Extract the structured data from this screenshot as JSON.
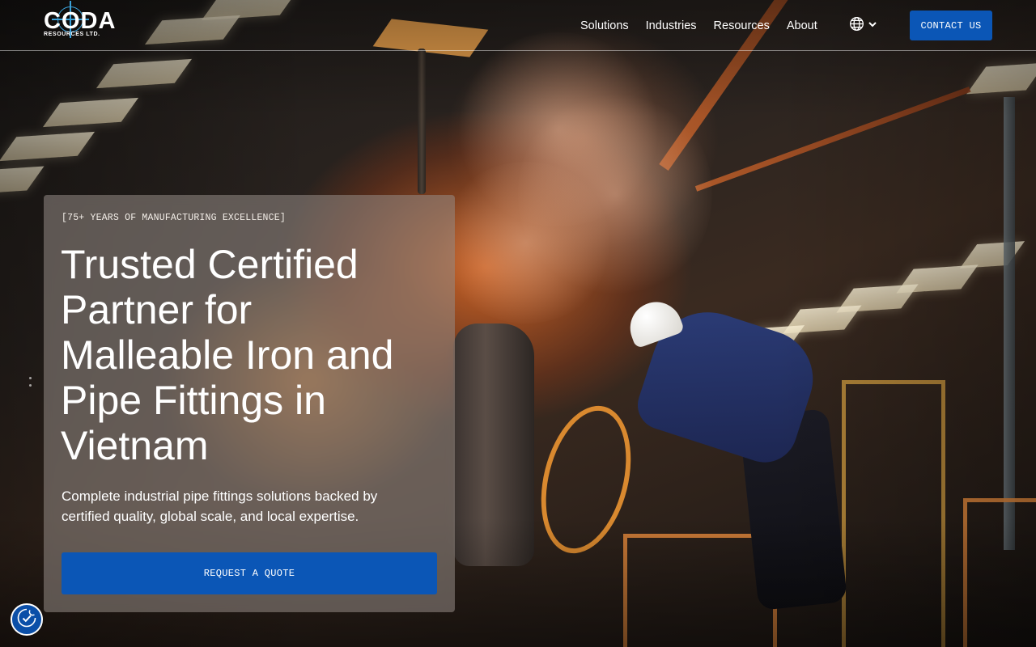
{
  "brand": {
    "name": "CODA",
    "sub": "RESOURCES LTD."
  },
  "nav": {
    "items": [
      {
        "label": "Solutions"
      },
      {
        "label": "Industries"
      },
      {
        "label": "Resources"
      },
      {
        "label": "About"
      }
    ],
    "language_icon": "globe-icon",
    "language_chevron_icon": "chevron-down-icon",
    "contact_label": "CONTACT US"
  },
  "hero": {
    "eyebrow": "[75+ YEARS OF MANUFACTURING EXCELLENCE]",
    "headline": "Trusted Certified Partner for Malleable Iron and Pipe Fittings in Vietnam",
    "subtext": "Complete industrial pipe fittings solutions backed by certified quality, global scale, and local expertise.",
    "cta_label": "REQUEST A QUOTE",
    "background_image": "foundry-worker-pouring-molten-iron"
  },
  "cookie": {
    "icon": "cookie-settings-icon"
  },
  "colors": {
    "accent": "#0b56b6",
    "logo_mark": "#3aa0d8",
    "text": "#ffffff"
  }
}
